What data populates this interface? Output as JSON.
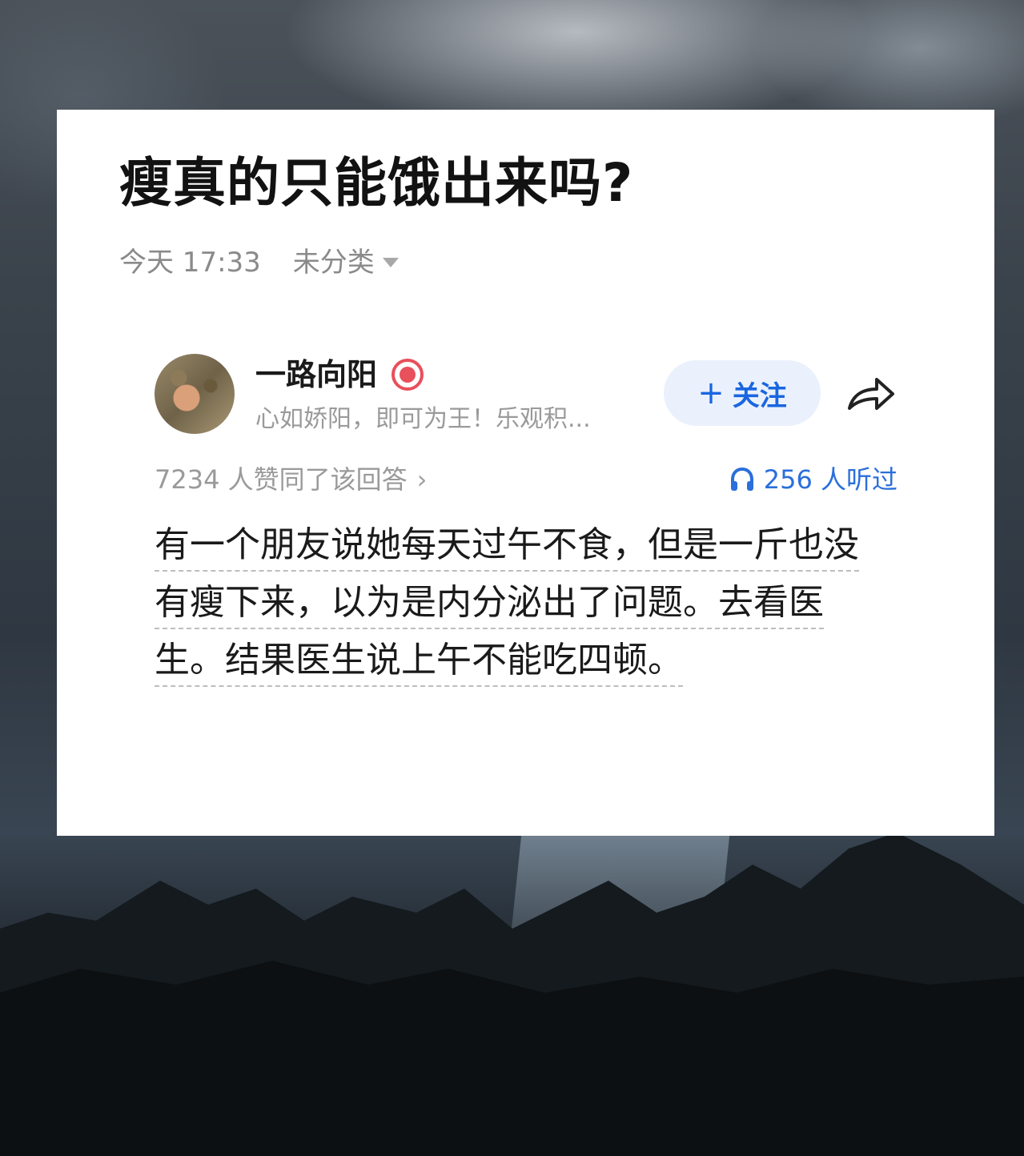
{
  "post": {
    "title": "瘦真的只能饿出来吗?",
    "time": "今天 17:33",
    "category": "未分类"
  },
  "author": {
    "name": "一路向阳",
    "bio": "心如娇阳，即可为王！乐观积...",
    "follow_label": "关注",
    "follow_plus": "+"
  },
  "stats": {
    "likes": "7234 人赞同了该回答",
    "likes_chevron": "›",
    "listens": "256 人听过"
  },
  "answer": {
    "text": "有一个朋友说她每天过午不食，但是一斤也没有瘦下来，以为是内分泌出了问题。去看医生。结果医生说上午不能吃四顿。"
  },
  "icons": {
    "caret": "caret-down-icon",
    "badge": "thumbs-up-badge-icon",
    "share": "share-arrow-icon",
    "headphone": "headphone-icon"
  },
  "colors": {
    "accent_blue": "#1a66e0",
    "badge_red": "#e8505b",
    "follow_bg": "#eaf1fd"
  }
}
